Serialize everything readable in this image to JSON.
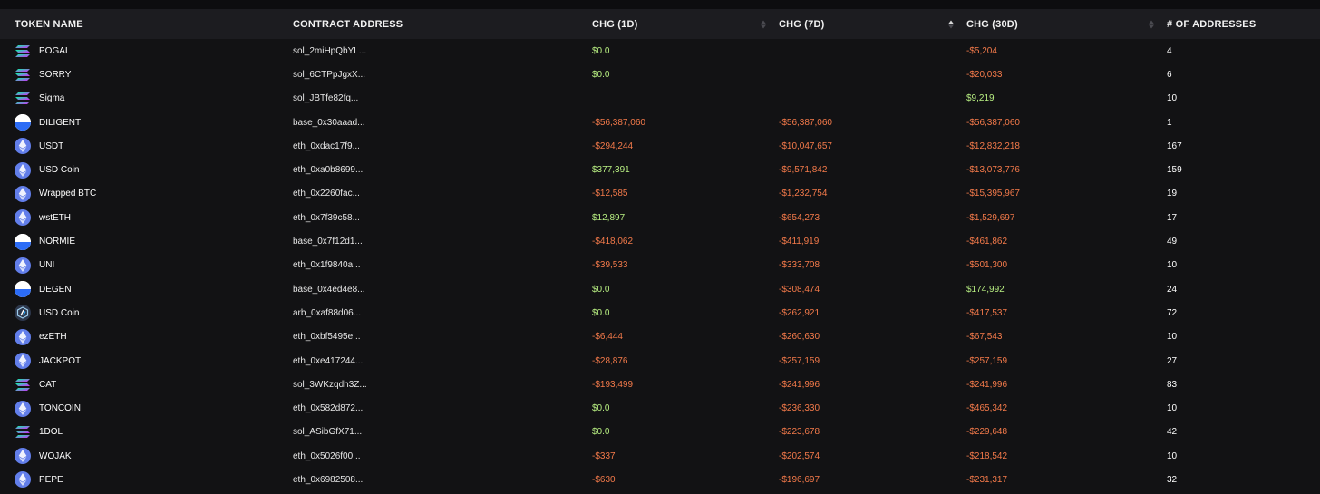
{
  "columns": {
    "token_name": "TOKEN NAME",
    "contract_address": "CONTRACT ADDRESS",
    "chg_1d": "CHG (1D)",
    "chg_7d": "CHG (7D)",
    "chg_30d": "CHG (30D)",
    "num_addresses": "# OF ADDRESSES"
  },
  "sorted_column": "chg_7d",
  "colors": {
    "positive": "#b8ef82",
    "negative": "#f47a4a",
    "header_bg": "#1c1c20",
    "page_bg": "#121214"
  },
  "rows": [
    {
      "icon": "solana-icon",
      "chain": "sol",
      "name": "POGAI",
      "address": "sol_2miHpQbYL...",
      "d1": "$0.0",
      "d7": "",
      "d30": "-$5,204",
      "count": "4"
    },
    {
      "icon": "solana-icon",
      "chain": "sol",
      "name": "SORRY",
      "address": "sol_6CTPpJgxX...",
      "d1": "$0.0",
      "d7": "",
      "d30": "-$20,033",
      "count": "6"
    },
    {
      "icon": "solana-icon",
      "chain": "sol",
      "name": "Sigma",
      "address": "sol_JBTfe82fq...",
      "d1": "",
      "d7": "",
      "d30": "$9,219",
      "count": "10"
    },
    {
      "icon": "base-icon",
      "chain": "base",
      "name": "DILIGENT",
      "address": "base_0x30aaad...",
      "d1": "-$56,387,060",
      "d7": "-$56,387,060",
      "d30": "-$56,387,060",
      "count": "1"
    },
    {
      "icon": "ethereum-icon",
      "chain": "eth",
      "name": "USDT",
      "address": "eth_0xdac17f9...",
      "d1": "-$294,244",
      "d7": "-$10,047,657",
      "d30": "-$12,832,218",
      "count": "167"
    },
    {
      "icon": "ethereum-icon",
      "chain": "eth",
      "name": "USD Coin",
      "address": "eth_0xa0b8699...",
      "d1": "$377,391",
      "d7": "-$9,571,842",
      "d30": "-$13,073,776",
      "count": "159"
    },
    {
      "icon": "ethereum-icon",
      "chain": "eth",
      "name": "Wrapped BTC",
      "address": "eth_0x2260fac...",
      "d1": "-$12,585",
      "d7": "-$1,232,754",
      "d30": "-$15,395,967",
      "count": "19"
    },
    {
      "icon": "ethereum-icon",
      "chain": "eth",
      "name": "wstETH",
      "address": "eth_0x7f39c58...",
      "d1": "$12,897",
      "d7": "-$654,273",
      "d30": "-$1,529,697",
      "count": "17"
    },
    {
      "icon": "base-icon",
      "chain": "base",
      "name": "NORMIE",
      "address": "base_0x7f12d1...",
      "d1": "-$418,062",
      "d7": "-$411,919",
      "d30": "-$461,862",
      "count": "49"
    },
    {
      "icon": "ethereum-icon",
      "chain": "eth",
      "name": "UNI",
      "address": "eth_0x1f9840a...",
      "d1": "-$39,533",
      "d7": "-$333,708",
      "d30": "-$501,300",
      "count": "10"
    },
    {
      "icon": "base-icon",
      "chain": "base",
      "name": "DEGEN",
      "address": "base_0x4ed4e8...",
      "d1": "$0.0",
      "d7": "-$308,474",
      "d30": "$174,992",
      "count": "24"
    },
    {
      "icon": "arbitrum-icon",
      "chain": "arb",
      "name": "USD Coin",
      "address": "arb_0xaf88d06...",
      "d1": "$0.0",
      "d7": "-$262,921",
      "d30": "-$417,537",
      "count": "72"
    },
    {
      "icon": "ethereum-icon",
      "chain": "eth",
      "name": "ezETH",
      "address": "eth_0xbf5495e...",
      "d1": "-$6,444",
      "d7": "-$260,630",
      "d30": "-$67,543",
      "count": "10"
    },
    {
      "icon": "ethereum-icon",
      "chain": "eth",
      "name": "JACKPOT",
      "address": "eth_0xe417244...",
      "d1": "-$28,876",
      "d7": "-$257,159",
      "d30": "-$257,159",
      "count": "27"
    },
    {
      "icon": "solana-icon",
      "chain": "sol",
      "name": "CAT",
      "address": "sol_3WKzqdh3Z...",
      "d1": "-$193,499",
      "d7": "-$241,996",
      "d30": "-$241,996",
      "count": "83"
    },
    {
      "icon": "ethereum-icon",
      "chain": "eth",
      "name": "TONCOIN",
      "address": "eth_0x582d872...",
      "d1": "$0.0",
      "d7": "-$236,330",
      "d30": "-$465,342",
      "count": "10"
    },
    {
      "icon": "solana-icon",
      "chain": "sol",
      "name": "1DOL",
      "address": "sol_ASibGfX71...",
      "d1": "$0.0",
      "d7": "-$223,678",
      "d30": "-$229,648",
      "count": "42"
    },
    {
      "icon": "ethereum-icon",
      "chain": "eth",
      "name": "WOJAK",
      "address": "eth_0x5026f00...",
      "d1": "-$337",
      "d7": "-$202,574",
      "d30": "-$218,542",
      "count": "10"
    },
    {
      "icon": "ethereum-icon",
      "chain": "eth",
      "name": "PEPE",
      "address": "eth_0x6982508...",
      "d1": "-$630",
      "d7": "-$196,697",
      "d30": "-$231,317",
      "count": "32"
    }
  ]
}
